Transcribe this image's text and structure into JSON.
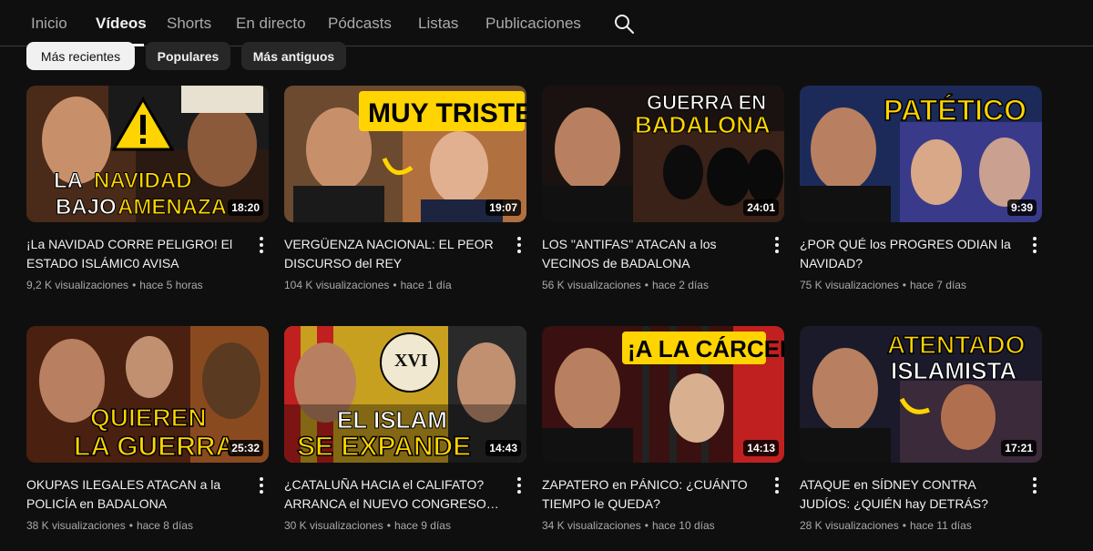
{
  "tabs": [
    {
      "label": "Inicio",
      "active": false
    },
    {
      "label": "Vídeos",
      "active": true
    },
    {
      "label": "Shorts",
      "active": false
    },
    {
      "label": "En directo",
      "active": false
    },
    {
      "label": "Pódcasts",
      "active": false
    },
    {
      "label": "Listas",
      "active": false
    },
    {
      "label": "Publicaciones",
      "active": false
    }
  ],
  "search_icon": "search-icon",
  "chips": [
    {
      "label": "Más recientes",
      "selected": true
    },
    {
      "label": "Populares",
      "selected": false
    },
    {
      "label": "Más antiguos",
      "selected": false
    }
  ],
  "videos": [
    {
      "thumb_text": "LA NAVIDAD BAJO AMENAZA",
      "duration": "18:20",
      "title": "¡La NAVIDAD CORRE PELIGRO! El ESTADO ISLÁMIC0 AVISA",
      "views": "9,2 K visualizaciones",
      "age": "hace 5 horas"
    },
    {
      "thumb_text": "MUY TRISTE",
      "duration": "19:07",
      "title": "VERGÜENZA NACIONAL: EL PEOR DISCURSO del REY",
      "views": "104 K visualizaciones",
      "age": "hace 1 día"
    },
    {
      "thumb_text": "GUERRA EN BADALONA",
      "duration": "24:01",
      "title": "LOS \"ANTIFAS\" ATACAN a los VECINOS de BADALONA",
      "views": "56 K visualizaciones",
      "age": "hace 2 días"
    },
    {
      "thumb_text": "PATÉTICO",
      "duration": "9:39",
      "title": "¿POR QUÉ los PROGRES ODIAN la NAVIDAD?",
      "views": "75 K visualizaciones",
      "age": "hace 7 días"
    },
    {
      "thumb_text": "QUIEREN LA GUERRA",
      "duration": "25:32",
      "title": "OKUPAS ILEGALES ATACAN a la POLICÍA en BADALONA",
      "views": "38 K visualizaciones",
      "age": "hace 8 días"
    },
    {
      "thumb_text": "EL ISLAM SE EXPANDE",
      "duration": "14:43",
      "title": "¿CATALUÑA HACIA el CALIFATO? ARRANCA el NUEVO CONGRESO…",
      "views": "30 K visualizaciones",
      "age": "hace 9 días"
    },
    {
      "thumb_text": "¡A LA CÁRCEL!",
      "duration": "14:13",
      "title": "ZAPATERO en PÁNICO: ¿CUÁNTO TIEMPO le QUEDA?",
      "views": "34 K visualizaciones",
      "age": "hace 10 días"
    },
    {
      "thumb_text": "ATENTADO ISLAMISTA",
      "duration": "17:21",
      "title": "ATAQUE en SÍDNEY CONTRA JUDÍOS: ¿QUIÉN hay DETRÁS?",
      "views": "28 K visualizaciones",
      "age": "hace 11 días"
    }
  ],
  "colors": {
    "background": "#0f0f0f",
    "chip_selected": "#f1f1f1",
    "chip": "#272727",
    "thumb_text": "#ffd400",
    "secondary_text": "#aaaaaa"
  }
}
